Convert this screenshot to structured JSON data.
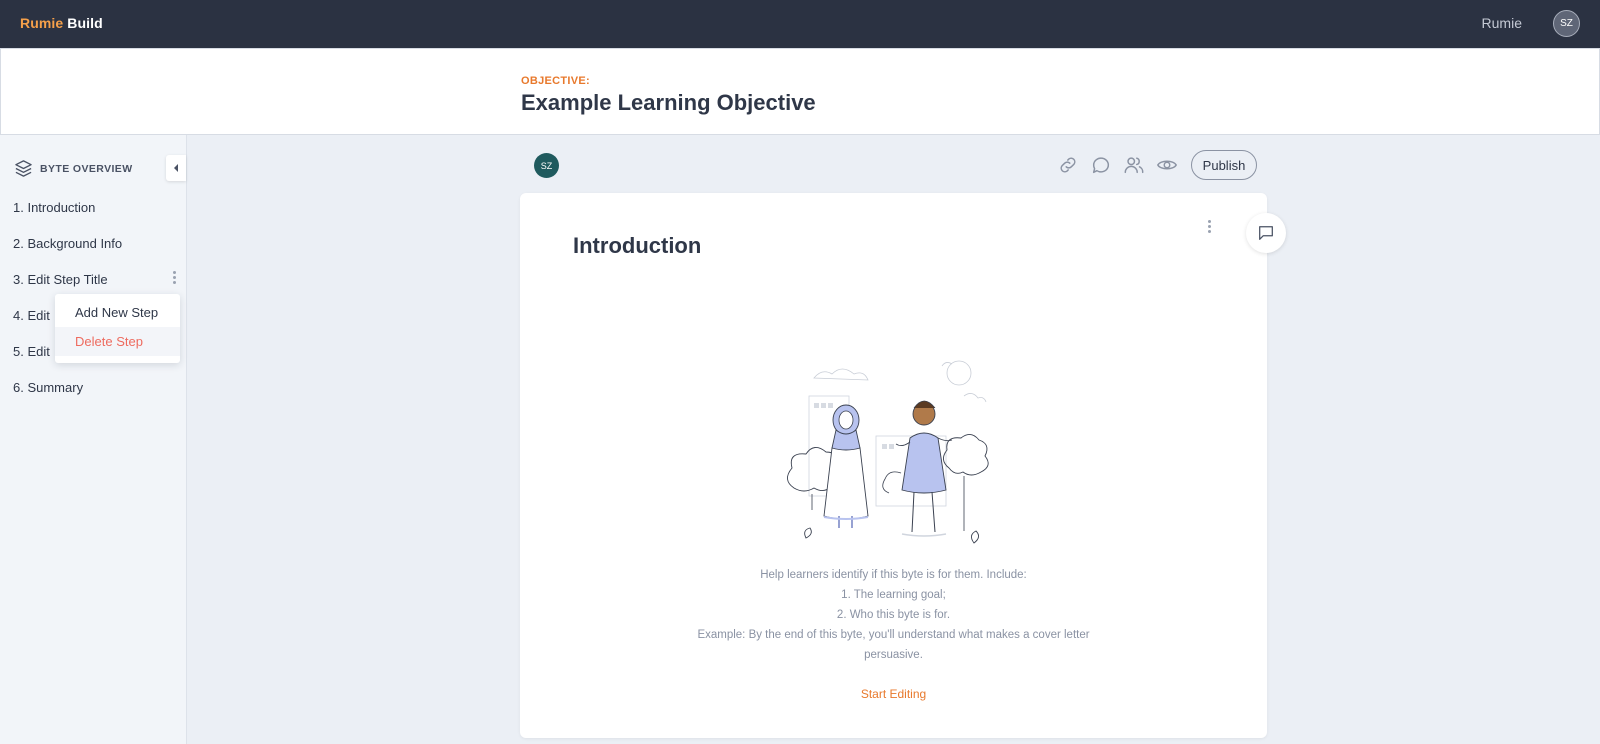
{
  "app": {
    "brand_primary": "Rumie",
    "brand_secondary": "Build"
  },
  "user": {
    "name": "Rumie",
    "initials": "SZ"
  },
  "header": {
    "objective_label": "OBJECTIVE:",
    "objective_title": "Example Learning Objective"
  },
  "sidebar": {
    "title": "BYTE OVERVIEW",
    "steps": [
      {
        "label": "1. Introduction"
      },
      {
        "label": "2. Background Info"
      },
      {
        "label": "3. Edit Step Title"
      },
      {
        "label": "4. Edit"
      },
      {
        "label": "5. Edit"
      },
      {
        "label": "6. Summary"
      }
    ],
    "context_menu": {
      "add": "Add New Step",
      "delete": "Delete Step"
    }
  },
  "toolbar": {
    "collaborator_initials": "SZ",
    "icons": [
      "link-icon",
      "comment-icon",
      "users-icon",
      "eye-icon"
    ],
    "publish_label": "Publish"
  },
  "card": {
    "title": "Introduction",
    "help_lines": [
      "Help learners identify if this byte is for them. Include:",
      "1. The learning goal;",
      "2. Who this byte is for.",
      "Example: By the end of this byte, you'll understand what makes a cover letter persuasive."
    ],
    "start_editing": "Start Editing"
  },
  "colors": {
    "accent": "#e8792c",
    "topbar": "#2b3242",
    "danger": "#ee6b5f",
    "avatar": "#1f5a5e"
  }
}
